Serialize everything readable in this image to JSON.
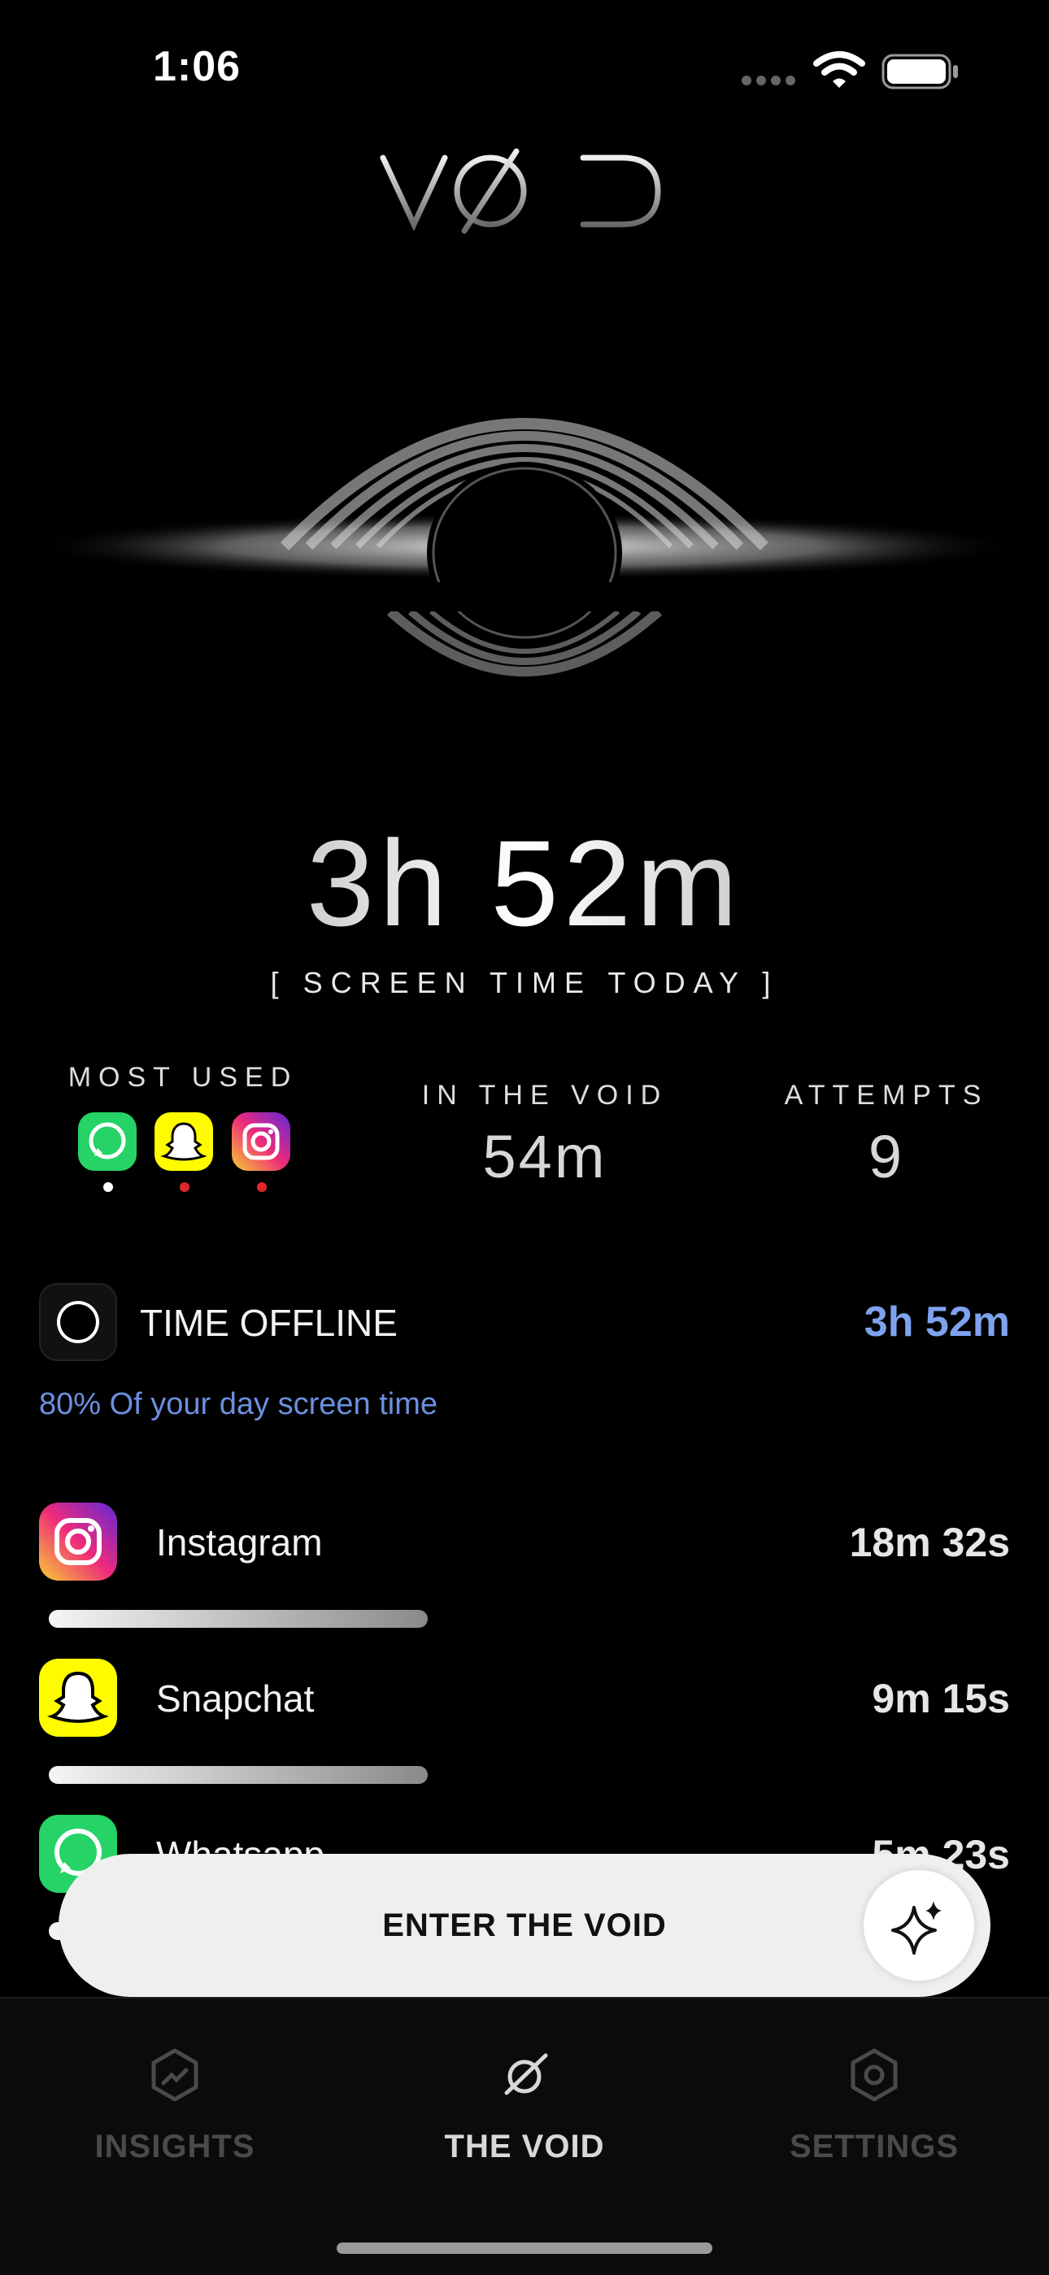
{
  "status_bar": {
    "time": "1:06"
  },
  "logo": {
    "text": "VØID"
  },
  "hero": {
    "screen_time": "3h 52m",
    "screen_time_label": "[ SCREEN TIME TODAY ]"
  },
  "stats": {
    "most_used_label": "MOST USED",
    "most_used_apps": [
      "whatsapp-icon",
      "snapchat-icon",
      "instagram-icon"
    ],
    "in_void_label": "IN THE VOID",
    "in_void_value": "54m",
    "attempts_label": "ATTEMPTS",
    "attempts_value": "9"
  },
  "offline": {
    "label": "TIME OFFLINE",
    "value": "3h 52m",
    "subtitle": "80% Of your day screen time"
  },
  "apps": [
    {
      "name": "Instagram",
      "time": "18m 32s",
      "icon": "instagram-icon",
      "usage_fraction": 0.39
    },
    {
      "name": "Snapchat",
      "time": "9m 15s",
      "icon": "snapchat-icon",
      "usage_fraction": 0.39
    },
    {
      "name": "Whatsapp",
      "time": "5m 23s",
      "icon": "whatsapp-icon",
      "usage_fraction": 0.39
    }
  ],
  "cta": {
    "label": "ENTER THE VOID"
  },
  "tabs": [
    {
      "label": "INSIGHTS",
      "icon": "insights-icon",
      "active": false
    },
    {
      "label": "THE VOID",
      "icon": "planet-icon",
      "active": true
    },
    {
      "label": "SETTINGS",
      "icon": "settings-icon",
      "active": false
    }
  ],
  "colors": {
    "accent_blue": "#7ea2ee",
    "background": "#000000"
  }
}
